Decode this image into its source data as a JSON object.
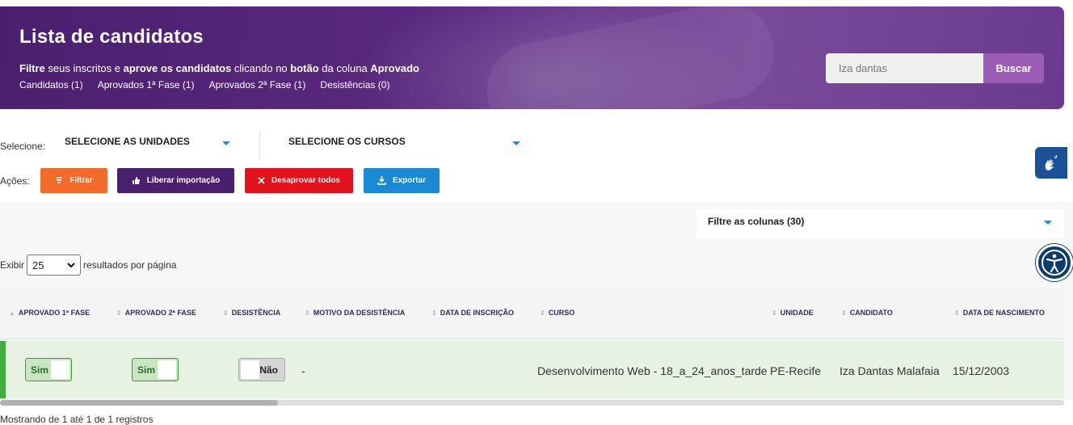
{
  "header": {
    "title": "Lista de candidatos",
    "sub_parts": [
      "Filtre",
      " seus inscritos e ",
      "aprove os candidatos",
      " clicando no ",
      "botão",
      " da coluna ",
      "Aprovado"
    ],
    "counts": [
      "Candidatos (1)",
      "Aprovados 1ª Fase (1)",
      "Aprovados 2ª Fase (1)",
      "Desistências (0)"
    ],
    "search_value": "Iza dantas",
    "search_button": "Buscar"
  },
  "filters": {
    "select_label": "Selecione:",
    "units_dropdown": "SELECIONE AS UNIDADES",
    "courses_dropdown": "SELECIONE OS CURSOS",
    "actions_label": "Ações:",
    "actions": [
      {
        "label": "Filtrar",
        "color": "#f26b2b",
        "icon": "filter-icon"
      },
      {
        "label": "Liberar importação",
        "color": "#4a1f6e",
        "icon": "thumbs-up-icon"
      },
      {
        "label": "Desaprovar todos",
        "color": "#e3111b",
        "icon": "close-icon"
      },
      {
        "label": "Exportar",
        "color": "#1a8ad4",
        "icon": "download-icon"
      }
    ]
  },
  "columns_filter": "Filtre as colunas (30)",
  "pager": {
    "prefix": "Exibir",
    "value": "25",
    "suffix": "resultados por página"
  },
  "table": {
    "headers": [
      "APROVADO 1ª FASE",
      "APROVADO 2ª FASE",
      "DESISTÊNCIA",
      "MOTIVO DA DESISTÊNCIA",
      "DATA DE INSCRIÇÃO",
      "CURSO",
      "UNIDADE",
      "CANDIDATO",
      "DATA DE NASCIMENTO"
    ],
    "row": {
      "aprovado1": "Sim",
      "aprovado2": "Sim",
      "desistencia": "Não",
      "motivo": "-",
      "data_inscricao": "",
      "curso": "Desenvolvimento Web - 18_a_24_anos_tarde",
      "unidade": "PE-Recife",
      "candidato": "Iza Dantas Malafaia",
      "nascimento": "15/12/2003"
    }
  },
  "footer": "Mostrando de 1 até 1 de 1 registros",
  "colors": {
    "brand": "#5c2a82",
    "accent_green": "#3fae3f"
  }
}
